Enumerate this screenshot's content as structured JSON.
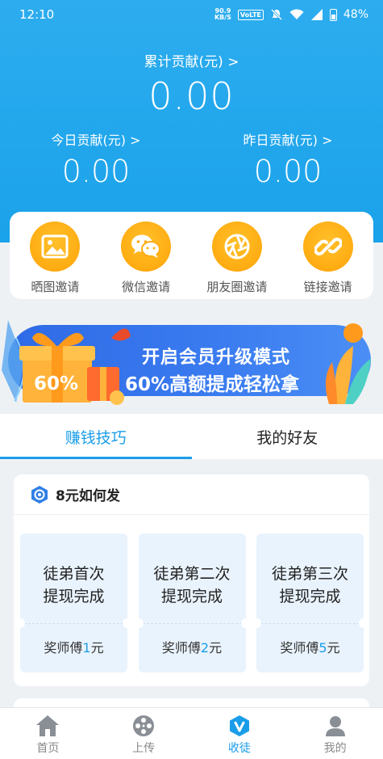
{
  "status_bar": {
    "time": "12:10",
    "net_speed": "90.9",
    "net_speed_unit": "KB/S",
    "volte": "VoLTE",
    "battery": "48%"
  },
  "header": {
    "total_label": "累计贡献(元) >",
    "total_value": "0.00",
    "today_label": "今日贡献(元) >",
    "today_value": "0.00",
    "yesterday_label": "昨日贡献(元) >",
    "yesterday_value": "0.00"
  },
  "invite": {
    "items": [
      {
        "label": "晒图邀请",
        "icon": "image-icon"
      },
      {
        "label": "微信邀请",
        "icon": "wechat-icon"
      },
      {
        "label": "朋友圈邀请",
        "icon": "moments-icon"
      },
      {
        "label": "链接邀请",
        "icon": "link-icon"
      }
    ]
  },
  "banner": {
    "box_text": "60%",
    "line1": "开启会员升级模式",
    "line2": "60%高额提成轻松拿"
  },
  "tabs": [
    {
      "label": "赚钱技巧",
      "active": true
    },
    {
      "label": "我的好友",
      "active": false
    }
  ],
  "how": {
    "title": "8元如何发",
    "steps": [
      {
        "title": "徒弟首次\n提现完成",
        "reward_prefix": "奖师傅",
        "reward_amount": "1",
        "reward_unit": "元"
      },
      {
        "title": "徒弟第二次\n提现完成",
        "reward_prefix": "奖师傅",
        "reward_amount": "2",
        "reward_unit": "元"
      },
      {
        "title": "徒弟第三次\n提现完成",
        "reward_prefix": "奖师傅",
        "reward_amount": "5",
        "reward_unit": "元"
      }
    ]
  },
  "bottom_nav": [
    {
      "label": "首页",
      "icon": "home-icon",
      "active": false
    },
    {
      "label": "上传",
      "icon": "film-reel-icon",
      "active": false
    },
    {
      "label": "收徒",
      "icon": "apprentice-badge-icon",
      "active": true
    },
    {
      "label": "我的",
      "icon": "profile-icon",
      "active": false
    }
  ],
  "colors": {
    "primary_blue": "#1a9de8",
    "header_blue": "#2dadef",
    "invite_orange": "#ffac12",
    "banner_blue": "#3b7cf0"
  }
}
